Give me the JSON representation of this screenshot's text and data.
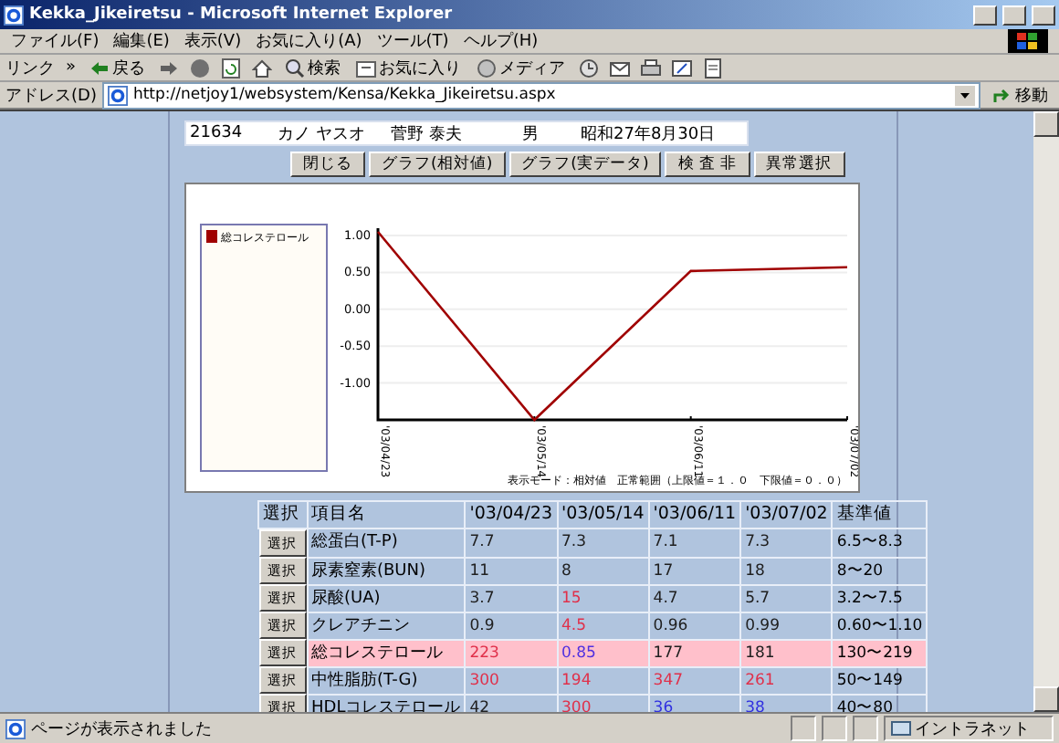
{
  "window": {
    "title": "Kekka_Jikeiretsu - Microsoft Internet Explorer"
  },
  "menu": [
    "ファイル(F)",
    "編集(E)",
    "表示(V)",
    "お気に入り(A)",
    "ツール(T)",
    "ヘルプ(H)"
  ],
  "toolbar": {
    "links": "リンク",
    "more": "»",
    "back": "戻る",
    "search": "検索",
    "favorites": "お気に入り",
    "media": "メディア"
  },
  "address": {
    "label": "アドレス(D)",
    "url": "http://netjoy1/websystem/Kensa/Kekka_Jikeiretsu.aspx",
    "go": "移動"
  },
  "patient": {
    "id": "21634",
    "kana": "カノ ヤスオ",
    "name": "菅野 泰夫",
    "sex": "男",
    "birth": "昭和27年8月30日"
  },
  "buttons": [
    "閉じる",
    "グラフ(相対値)",
    "グラフ(実データ)",
    "検 査 非",
    "異常選択"
  ],
  "chart": {
    "caption": "表示モード：相対値　正常範囲（上限値＝１．０　下限値＝０．０）",
    "chart_data": {
      "type": "line",
      "categories": [
        "'03/04/23",
        "'03/05/14",
        "'03/06/11",
        "'03/07/02"
      ],
      "grid": true,
      "series": [
        {
          "name": "総コレステロール",
          "color": "#a00000",
          "values": [
            1.05,
            -1.5,
            0.52,
            0.57
          ]
        }
      ],
      "ylim": [
        -1.5,
        1.1
      ],
      "yticks": [
        {
          "value": 1,
          "label": "1.00"
        },
        {
          "value": 0.5,
          "label": "0.50"
        },
        {
          "value": 0,
          "label": "0.00"
        },
        {
          "value": -0.5,
          "label": "-0.50"
        },
        {
          "value": -1,
          "label": "-1.00"
        }
      ]
    }
  },
  "table": {
    "columns": [
      "選択",
      "項目名",
      "'03/04/23",
      "'03/05/14",
      "'03/06/11",
      "'03/07/02",
      "基準値"
    ],
    "rows": [
      {
        "button": "選択",
        "item": "総蛋白(T-P)",
        "selected": false,
        "values": [
          {
            "text": "7.7",
            "color": "#202020"
          },
          {
            "text": "7.3",
            "color": "#202020"
          },
          {
            "text": "7.1",
            "color": "#202020"
          },
          {
            "text": "7.3",
            "color": "#202020"
          }
        ],
        "range": "6.5〜8.3"
      },
      {
        "button": "選択",
        "item": "尿素窒素(BUN)",
        "selected": false,
        "values": [
          {
            "text": "11",
            "color": "#202020"
          },
          {
            "text": "8",
            "color": "#202020"
          },
          {
            "text": "17",
            "color": "#202020"
          },
          {
            "text": "18",
            "color": "#202020"
          }
        ],
        "range": "8〜20"
      },
      {
        "button": "選択",
        "item": "尿酸(UA)",
        "selected": false,
        "values": [
          {
            "text": "3.7",
            "color": "#202020"
          },
          {
            "text": "15",
            "color": "#e0304a"
          },
          {
            "text": "4.7",
            "color": "#202020"
          },
          {
            "text": "5.7",
            "color": "#202020"
          }
        ],
        "range": "3.2〜7.5"
      },
      {
        "button": "選択",
        "item": "クレアチニン",
        "selected": false,
        "values": [
          {
            "text": "0.9",
            "color": "#202020"
          },
          {
            "text": "4.5",
            "color": "#e0304a"
          },
          {
            "text": "0.96",
            "color": "#202020"
          },
          {
            "text": "0.99",
            "color": "#202020"
          }
        ],
        "range": "0.60〜1.10"
      },
      {
        "button": "選択",
        "item": "総コレステロール",
        "selected": true,
        "values": [
          {
            "text": "223",
            "color": "#e0304a"
          },
          {
            "text": "0.85",
            "color": "#5030e0"
          },
          {
            "text": "177",
            "color": "#202020"
          },
          {
            "text": "181",
            "color": "#202020"
          }
        ],
        "range": "130〜219"
      },
      {
        "button": "選択",
        "item": "中性脂肪(T-G)",
        "selected": false,
        "values": [
          {
            "text": "300",
            "color": "#e0304a"
          },
          {
            "text": "194",
            "color": "#e0304a"
          },
          {
            "text": "347",
            "color": "#e0304a"
          },
          {
            "text": "261",
            "color": "#e0304a"
          }
        ],
        "range": "50〜149"
      },
      {
        "button": "選択",
        "item": "HDLコレステロール",
        "selected": false,
        "values": [
          {
            "text": "42",
            "color": "#202020"
          },
          {
            "text": "300",
            "color": "#e0304a"
          },
          {
            "text": "36",
            "color": "#3030e0"
          },
          {
            "text": "38",
            "color": "#3030e0"
          }
        ],
        "range": "40〜80"
      }
    ]
  },
  "status": {
    "text": "ページが表示されました",
    "zone": "イントラネット"
  }
}
